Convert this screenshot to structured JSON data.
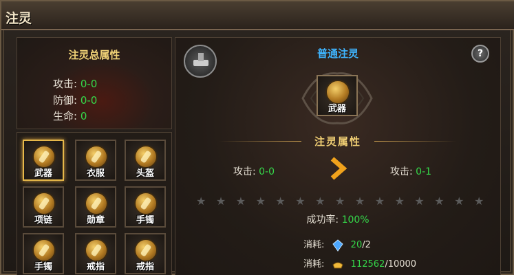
{
  "window": {
    "title": "注灵"
  },
  "total_attributes": {
    "heading": "注灵总属性",
    "rows": [
      {
        "label": "攻击:",
        "value": "0-0"
      },
      {
        "label": "防御:",
        "value": "0-0"
      },
      {
        "label": "生命:",
        "value": "0"
      }
    ]
  },
  "equipment_slots": [
    {
      "label": "武器",
      "selected": true
    },
    {
      "label": "衣服",
      "selected": false
    },
    {
      "label": "头盔",
      "selected": false
    },
    {
      "label": "项链",
      "selected": false
    },
    {
      "label": "勋章",
      "selected": false
    },
    {
      "label": "手镯",
      "selected": false
    },
    {
      "label": "手镯",
      "selected": false
    },
    {
      "label": "戒指",
      "selected": false
    },
    {
      "label": "戒指",
      "selected": false
    }
  ],
  "main": {
    "title": "普通注灵",
    "help": "?",
    "selected_slot_label": "武器",
    "attr_header": "注灵属性",
    "current": {
      "label": "攻击:",
      "value": "0-0"
    },
    "next": {
      "label": "攻击:",
      "value": "0-1"
    },
    "stars_total": 15,
    "stars_filled": 0,
    "success_rate": {
      "label": "成功率:",
      "value": "100%"
    },
    "costs": [
      {
        "label": "消耗:",
        "icon": "crystal-icon",
        "have": "20",
        "need": "/2"
      },
      {
        "label": "消耗:",
        "icon": "gold-ingot-icon",
        "have": "112562",
        "need": "/10000"
      }
    ]
  },
  "colors": {
    "green_value": "#35d94a",
    "gold_title": "#f0d277",
    "blue_title": "#3fb5ff"
  }
}
